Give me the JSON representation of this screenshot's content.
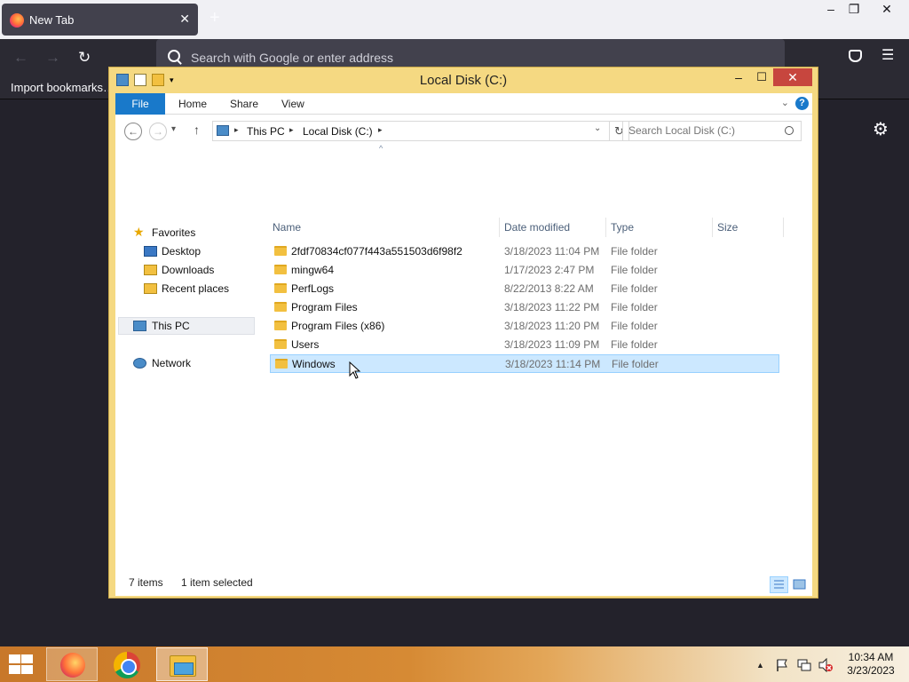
{
  "browser": {
    "tab_title": "New Tab",
    "tab_close": "✕",
    "new_tab": "+",
    "url_placeholder": "Search with Google or enter address",
    "import_bookmarks": "Import bookmarks…",
    "window_controls": {
      "minimize": "–",
      "restore": "❐",
      "close": "✕"
    },
    "nav": {
      "back": "←",
      "forward": "→",
      "reload": "↻",
      "menu": "☰",
      "settings": "⚙"
    }
  },
  "explorer": {
    "title": "Local Disk (C:)",
    "window_controls": {
      "minimize": "–",
      "maximize": "☐",
      "close": "✕"
    },
    "ribbon": {
      "tabs": [
        "File",
        "Home",
        "Share",
        "View"
      ],
      "help": "?",
      "collapse": "⌄"
    },
    "address": {
      "back": "←",
      "forward": "→",
      "recent": "▾",
      "up": "↑",
      "breadcrumb": [
        "This PC",
        "Local Disk (C:)"
      ],
      "sep": "▸",
      "dropdown": "⌄",
      "refresh": "↻",
      "search_placeholder": "Search Local Disk (C:)"
    },
    "nav_pane": {
      "favorites": "Favorites",
      "favorite_items": [
        "Desktop",
        "Downloads",
        "Recent places"
      ],
      "this_pc": "This PC",
      "network": "Network"
    },
    "columns": {
      "name": "Name",
      "date": "Date modified",
      "type": "Type",
      "size": "Size",
      "sort_indicator": "^"
    },
    "files": [
      {
        "name": "2fdf70834cf077f443a551503d6f98f2",
        "date": "3/18/2023 11:04 PM",
        "type": "File folder",
        "selected": false
      },
      {
        "name": "mingw64",
        "date": "1/17/2023 2:47 PM",
        "type": "File folder",
        "selected": false
      },
      {
        "name": "PerfLogs",
        "date": "8/22/2013 8:22 AM",
        "type": "File folder",
        "selected": false
      },
      {
        "name": "Program Files",
        "date": "3/18/2023 11:22 PM",
        "type": "File folder",
        "selected": false
      },
      {
        "name": "Program Files (x86)",
        "date": "3/18/2023 11:20 PM",
        "type": "File folder",
        "selected": false
      },
      {
        "name": "Users",
        "date": "3/18/2023 11:09 PM",
        "type": "File folder",
        "selected": false
      },
      {
        "name": "Windows",
        "date": "3/18/2023 11:14 PM",
        "type": "File folder",
        "selected": true
      }
    ],
    "status": {
      "count": "7 items",
      "selection": "1 item selected"
    }
  },
  "taskbar": {
    "tray_chevron": "▲",
    "time": "10:34 AM",
    "date": "3/23/2023"
  },
  "colors": {
    "accent": "#1979ca",
    "explorer_frame": "#f5d982",
    "selection": "#cce8ff"
  }
}
